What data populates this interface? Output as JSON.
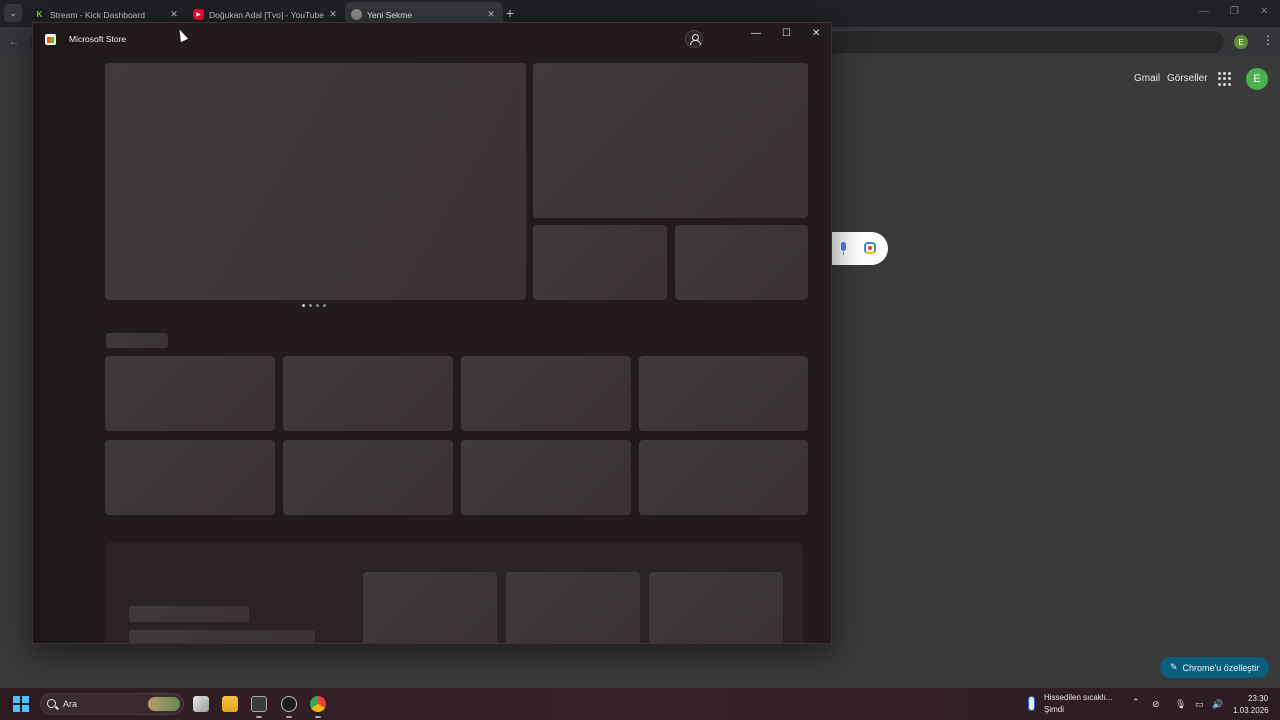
{
  "browser": {
    "tabs": [
      {
        "title": "Stream - Kick Dashboard",
        "favicon": "kick-icon"
      },
      {
        "title": "Doğukan Adal [Tvo] - YouTube",
        "favicon": "youtube-icon"
      },
      {
        "title": "Yeni Sekme",
        "favicon": "chrome-icon",
        "active": true
      }
    ],
    "profile_initial": "E"
  },
  "ntp": {
    "gmail_label": "Gmail",
    "images_label": "Görseller",
    "avatar_initial": "E",
    "customize_label": "Chrome'u özelleştir"
  },
  "store_window": {
    "title": "Microsoft Store",
    "state": "loading"
  },
  "taskbar": {
    "search_label": "Ara",
    "weather_line1": "Hissedilen sıcaklı...",
    "weather_line2": "Şimdi",
    "time": "23:30",
    "date": "1.03.2026",
    "accent_color": "#4cc2ff"
  }
}
